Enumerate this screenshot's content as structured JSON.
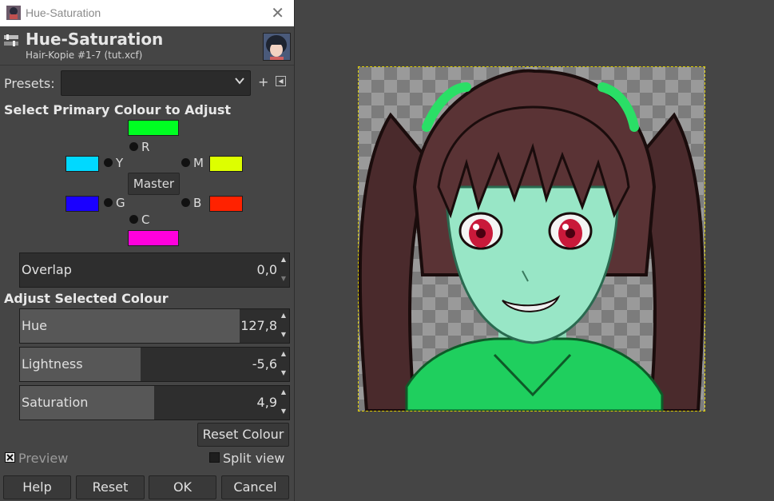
{
  "window": {
    "title": "Hue-Saturation",
    "close_glyph": "✕"
  },
  "header": {
    "title": "Hue-Saturation",
    "subtitle": "Hair-Kopie #1-7 (tut.xcf)"
  },
  "presets": {
    "label": "Presets:",
    "value": "",
    "add_glyph": "+",
    "menu_glyph": "◂"
  },
  "primary": {
    "heading": "Select Primary Colour to Adjust",
    "master_label": "Master",
    "colors": [
      {
        "key": "R",
        "color": "#00ff22"
      },
      {
        "key": "Y",
        "color": "#00d9ff"
      },
      {
        "key": "M",
        "color": "#ddff00"
      },
      {
        "key": "G",
        "color": "#1a00ff"
      },
      {
        "key": "B",
        "color": "#ff2200"
      },
      {
        "key": "C",
        "color": "#ff00dd"
      }
    ]
  },
  "overlap": {
    "label": "Overlap",
    "value": "0,0"
  },
  "adjust": {
    "heading": "Adjust Selected Colour",
    "hue": {
      "label": "Hue",
      "value": "127,8"
    },
    "lightness": {
      "label": "Lightness",
      "value": "-5,6"
    },
    "saturation": {
      "label": "Saturation",
      "value": "4,9"
    }
  },
  "reset_colour_label": "Reset Colour",
  "preview": {
    "label": "Preview",
    "checked": true
  },
  "split_view": {
    "label": "Split view",
    "checked": false
  },
  "buttons": {
    "help": "Help",
    "reset": "Reset",
    "ok": "OK",
    "cancel": "Cancel"
  }
}
